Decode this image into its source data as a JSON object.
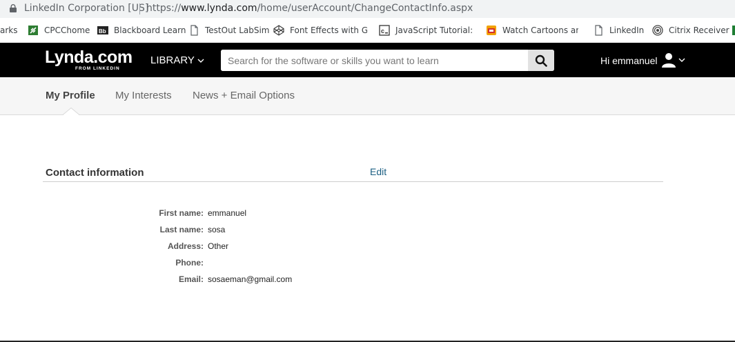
{
  "browser": {
    "owner": "LinkedIn Corporation [US]",
    "url_scheme": "https://",
    "url_host": "www.lynda.com",
    "url_path": "/home/userAccount/ChangeContactInfo.aspx",
    "bookmarks": [
      {
        "label": "arks",
        "icon": "star-icon"
      },
      {
        "label": "CPCChome",
        "icon": "link-icon"
      },
      {
        "label": "Blackboard Learn",
        "icon": "blackboard-icon"
      },
      {
        "label": "TestOut LabSim",
        "icon": "page-icon"
      },
      {
        "label": "Font Effects with Goo",
        "icon": "codepen-icon"
      },
      {
        "label": "JavaScript Tutorial: Le",
        "icon": "js-icon"
      },
      {
        "label": "Watch Cartoons and",
        "icon": "cartoon-icon"
      },
      {
        "label": "LinkedIn",
        "icon": "page-icon"
      },
      {
        "label": "Citrix Receiver",
        "icon": "citrix-icon"
      }
    ]
  },
  "header": {
    "logo_main": "Lynda.com",
    "logo_sub": "FROM LINKEDIN",
    "library_label": "LIBRARY",
    "search_placeholder": "Search for the software or skills you want to learn",
    "greeting": "Hi emmanuel"
  },
  "tabs": [
    {
      "label": "My Profile",
      "active": true
    },
    {
      "label": "My Interests",
      "active": false
    },
    {
      "label": "News + Email Options",
      "active": false
    }
  ],
  "contact": {
    "title": "Contact information",
    "edit_label": "Edit",
    "fields": [
      {
        "label": "First name:",
        "value": "emmanuel"
      },
      {
        "label": "Last name:",
        "value": "sosa"
      },
      {
        "label": "Address:",
        "value": "Other"
      },
      {
        "label": "Phone:",
        "value": ""
      },
      {
        "label": "Email:",
        "value": "sosaeman@gmail.com"
      }
    ]
  },
  "colors": {
    "header_bg": "#000000",
    "link": "#1a5e82",
    "tab_bar": "#f6f6f6"
  }
}
